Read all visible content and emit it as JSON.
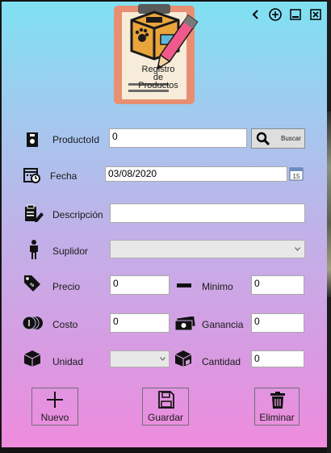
{
  "window": {
    "controls": {
      "back": "chevron-left-icon",
      "add": "plus-circle-icon",
      "minimize": "minimize-icon",
      "close": "close-icon"
    }
  },
  "logo": {
    "line1": "Registro",
    "line2": "de",
    "line3": "Productos"
  },
  "form": {
    "product_id": {
      "label": "ProductoId",
      "value": "0"
    },
    "search_button": {
      "label": "Buscar"
    },
    "fecha": {
      "label": "Fecha",
      "value": "03/08/2020"
    },
    "descripcion": {
      "label": "Descripción",
      "value": ""
    },
    "suplidor": {
      "label": "Suplidor",
      "value": ""
    },
    "precio": {
      "label": "Precio",
      "value": "0"
    },
    "minimo": {
      "label": "Minimo",
      "value": "0"
    },
    "costo": {
      "label": "Costo",
      "value": "0"
    },
    "ganancia": {
      "label": "Ganancia",
      "value": "0"
    },
    "unidad": {
      "label": "Unidad",
      "value": ""
    },
    "cantidad": {
      "label": "Cantidad",
      "value": "0"
    }
  },
  "actions": {
    "nuevo": "Nuevo",
    "guardar": "Guardar",
    "eliminar": "Eliminar"
  }
}
